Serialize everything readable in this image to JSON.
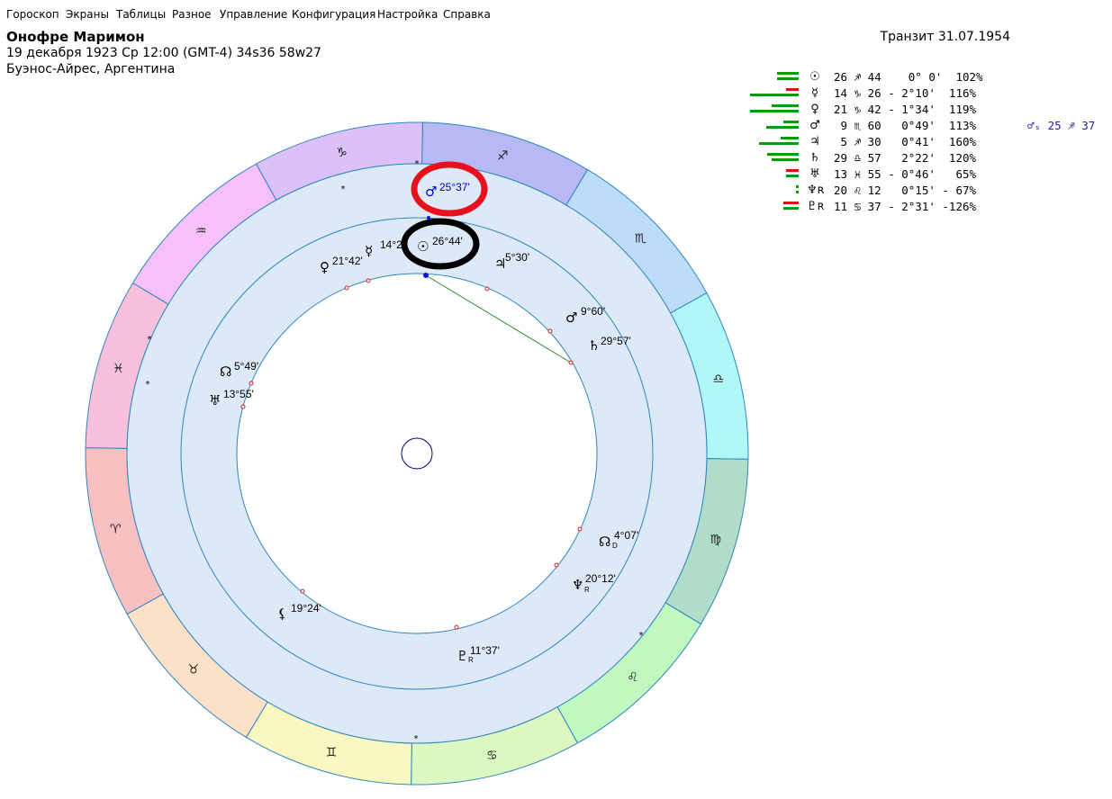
{
  "menu": [
    "Гороскоп",
    "Экраны",
    "Таблицы",
    "Разное",
    "Управление",
    "Конфигурация",
    "Настройка",
    "Справка"
  ],
  "header": {
    "name": "Онофре Маримон",
    "birth_line": "19 декабря 1923  Ср  12:00 (GMT-4) 34s36  58w27",
    "place": "Буэнос-Айрес, Аргентина",
    "transit": "Транзит 31.07.1954"
  },
  "colors": {
    "bar_positive": "#0a9a0a",
    "bar_negative": "#e01010",
    "transit_text": "#0000cc",
    "highlight_red_ring": "#e8101a",
    "highlight_black_ring": "#000000"
  },
  "planet_table": [
    {
      "glyph": "☉",
      "icon": "sun-icon",
      "text": "26 ♐ 44    0° 0'  102%",
      "extra": ""
    },
    {
      "glyph": "☿",
      "icon": "mercury-icon",
      "text": "14 ♑ 26 - 2°10'  116%",
      "extra": ""
    },
    {
      "glyph": "♀",
      "icon": "venus-icon",
      "text": "21 ♑ 42 - 1°34'  119%",
      "extra": ""
    },
    {
      "glyph": "♂",
      "icon": "mars-icon",
      "text": " 9 ♏ 60   0°49'  113%",
      "extra": "♂ₛ 25 ♐ 37"
    },
    {
      "glyph": "♃",
      "icon": "jupiter-icon",
      "text": " 5 ♐ 30   0°41'  160%",
      "extra": ""
    },
    {
      "glyph": "♄",
      "icon": "saturn-icon",
      "text": "29 ♎ 57   2°22'  120%",
      "extra": ""
    },
    {
      "glyph": "♅",
      "icon": "uranus-icon",
      "text": "13 ♓ 55 - 0°46'   65%",
      "extra": ""
    },
    {
      "glyph": "♆ʀ",
      "icon": "neptune-icon",
      "text": "20 ♌ 12   0°15' - 67%",
      "extra": ""
    },
    {
      "glyph": "♇ʀ",
      "icon": "pluto-icon",
      "text": "11 ♋ 37 - 2°31' -126%",
      "extra": ""
    }
  ],
  "zodiac": [
    {
      "glyph": "♐",
      "color": "#b8b8f4",
      "icon": "sagittarius-icon"
    },
    {
      "glyph": "♏",
      "color": "#bcdcf8",
      "icon": "scorpio-icon"
    },
    {
      "glyph": "♎",
      "color": "#b0f8f8",
      "icon": "libra-icon"
    },
    {
      "glyph": "♍",
      "color": "#b0dcc8",
      "icon": "virgo-icon"
    },
    {
      "glyph": "♌",
      "color": "#c0f8c0",
      "icon": "leo-icon"
    },
    {
      "glyph": "♋",
      "color": "#dcf8c0",
      "icon": "cancer-icon"
    },
    {
      "glyph": "♊",
      "color": "#f8f8c0",
      "icon": "gemini-icon"
    },
    {
      "glyph": "♉",
      "color": "#fce0c8",
      "icon": "taurus-icon"
    },
    {
      "glyph": "♈",
      "color": "#f8c0c0",
      "icon": "aries-icon"
    },
    {
      "glyph": "♓",
      "color": "#f8c0dc",
      "icon": "pisces-icon"
    },
    {
      "glyph": "♒",
      "color": "#f8c0f8",
      "icon": "aquarius-icon"
    },
    {
      "glyph": "♑",
      "color": "#dcc0f8",
      "icon": "capricorn-icon"
    }
  ],
  "transit_planets": [
    {
      "glyph": "♂",
      "label": "25°37'",
      "icon": "mars-transit-icon"
    }
  ],
  "natal_planets": [
    {
      "glyph": "☉",
      "label": "26°44'",
      "icon": "sun-icon"
    },
    {
      "glyph": "☿",
      "label": "14°2",
      "icon": "mercury-icon"
    },
    {
      "glyph": "♀",
      "label": "21°42'",
      "icon": "venus-icon"
    },
    {
      "glyph": "♃",
      "label": "5°30'",
      "icon": "jupiter-icon"
    },
    {
      "glyph": "♂",
      "label": "9°60'",
      "icon": "mars-icon"
    },
    {
      "glyph": "♄",
      "label": "29°57'",
      "icon": "saturn-icon"
    },
    {
      "glyph": "☊",
      "label": "5°49'",
      "icon": "south-node-icon"
    },
    {
      "glyph": "♅",
      "label": "13°55'",
      "icon": "uranus-icon"
    },
    {
      "glyph": "☊",
      "label": "4°07'",
      "sub": "D",
      "icon": "north-node-icon"
    },
    {
      "glyph": "♆",
      "label": "20°12'",
      "sub": "R",
      "icon": "neptune-icon"
    },
    {
      "glyph": "⚸",
      "label": "19°24'",
      "icon": "lilith-icon"
    },
    {
      "glyph": "♇",
      "label": "11°37'",
      "sub": "R",
      "icon": "pluto-icon"
    }
  ]
}
